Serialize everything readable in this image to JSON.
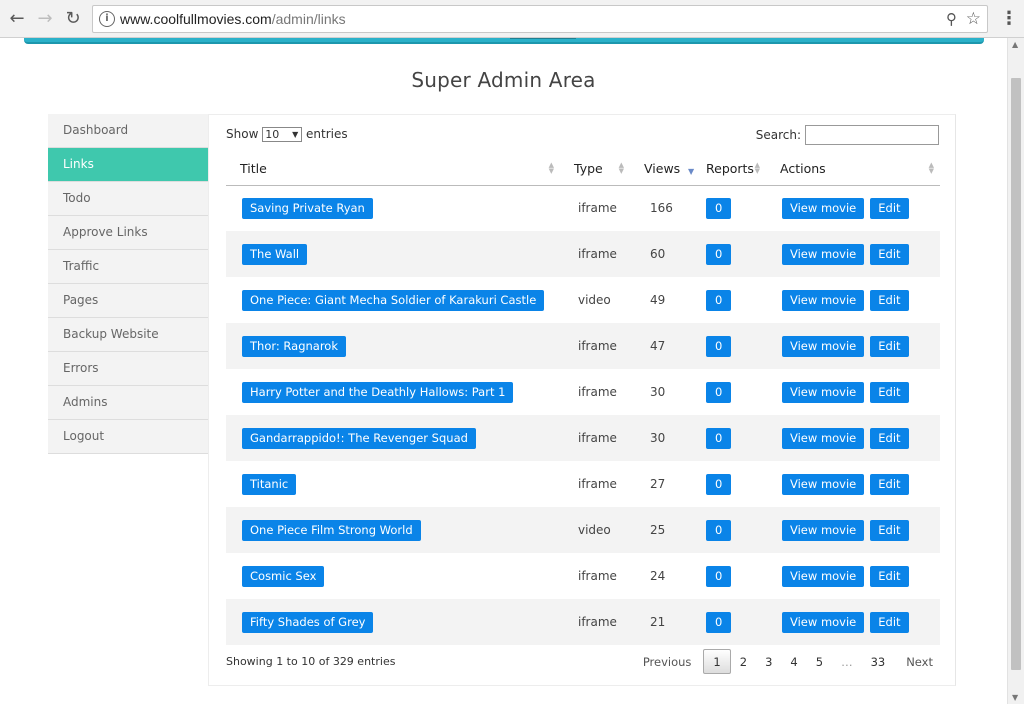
{
  "browser": {
    "url_host": "www.coolfullmovies.com",
    "url_path": "/admin/links"
  },
  "page": {
    "title": "Super Admin Area"
  },
  "sidebar": {
    "items": [
      {
        "label": "Dashboard",
        "active": false
      },
      {
        "label": "Links",
        "active": true
      },
      {
        "label": "Todo",
        "active": false
      },
      {
        "label": "Approve Links",
        "active": false
      },
      {
        "label": "Traffic",
        "active": false
      },
      {
        "label": "Pages",
        "active": false
      },
      {
        "label": "Backup Website",
        "active": false
      },
      {
        "label": "Errors",
        "active": false
      },
      {
        "label": "Admins",
        "active": false
      },
      {
        "label": "Logout",
        "active": false
      }
    ]
  },
  "table_controls": {
    "show_label": "Show",
    "entries_value": "10",
    "entries_label": "entries",
    "search_label": "Search:"
  },
  "table": {
    "headers": [
      "Title",
      "Type",
      "Views",
      "Reports",
      "Actions"
    ],
    "rows": [
      {
        "title": "Saving Private Ryan",
        "type": "iframe",
        "views": "166",
        "reports": "0"
      },
      {
        "title": "The Wall",
        "type": "iframe",
        "views": "60",
        "reports": "0"
      },
      {
        "title": "One Piece: Giant Mecha Soldier of Karakuri Castle",
        "type": "video",
        "views": "49",
        "reports": "0"
      },
      {
        "title": "Thor: Ragnarok",
        "type": "iframe",
        "views": "47",
        "reports": "0"
      },
      {
        "title": "Harry Potter and the Deathly Hallows: Part 1",
        "type": "iframe",
        "views": "30",
        "reports": "0"
      },
      {
        "title": "Gandarrappido!: The Revenger Squad",
        "type": "iframe",
        "views": "30",
        "reports": "0"
      },
      {
        "title": "Titanic",
        "type": "iframe",
        "views": "27",
        "reports": "0"
      },
      {
        "title": "One Piece Film Strong World",
        "type": "video",
        "views": "25",
        "reports": "0"
      },
      {
        "title": "Cosmic Sex",
        "type": "iframe",
        "views": "24",
        "reports": "0"
      },
      {
        "title": "Fifty Shades of Grey",
        "type": "iframe",
        "views": "21",
        "reports": "0"
      }
    ],
    "view_label": "View movie",
    "edit_label": "Edit"
  },
  "footer": {
    "info": "Showing 1 to 10 of 329 entries",
    "previous": "Previous",
    "next": "Next",
    "pages": [
      "1",
      "2",
      "3",
      "4",
      "5",
      "…",
      "33"
    ],
    "current_page": "1"
  },
  "colors": {
    "accent": "#3fc8ad",
    "button": "#0a84e8",
    "top_bar": "#2bb1c9"
  }
}
